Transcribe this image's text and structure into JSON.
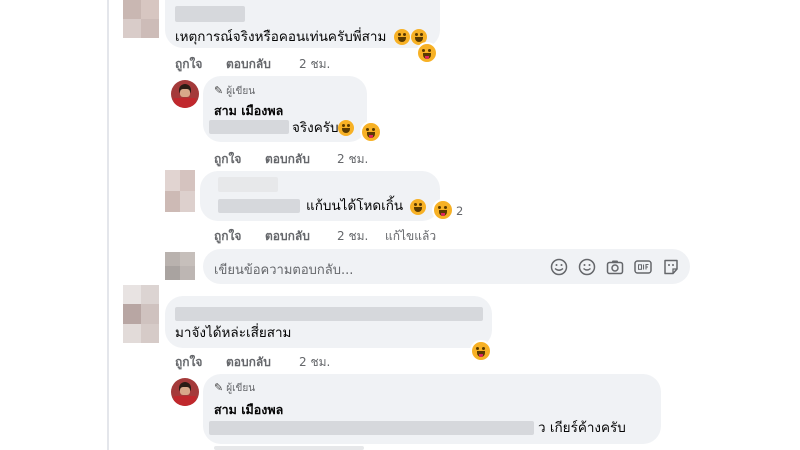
{
  "comments": [
    {
      "text": "เหตุการณ์จริงหรือคอนเท่นครับพี่สาม",
      "actions": {
        "like": "ถูกใจ",
        "reply": "ตอบกลับ",
        "time": "2 ชม."
      }
    },
    {
      "author_badge": "ผู้เขียน",
      "author_name": "สาม เมืองพล",
      "text": "จริงครับ",
      "actions": {
        "like": "ถูกใจ",
        "reply": "ตอบกลับ",
        "time": "2 ชม."
      }
    },
    {
      "text": "แก้บนได้โหดเกิ้น",
      "reaction_count": "2",
      "actions": {
        "like": "ถูกใจ",
        "reply": "ตอบกลับ",
        "time": "2 ชม.",
        "edited": "แก้ไขแล้ว"
      }
    },
    {
      "text": "มาจังได้หล่ะเสี่ยสาม",
      "actions": {
        "like": "ถูกใจ",
        "reply": "ตอบกลับ",
        "time": "2 ชม."
      }
    },
    {
      "author_badge": "ผู้เขียน",
      "author_name": "สาม เมืองพล",
      "text": "ว เกียร์ค้างครับ"
    }
  ],
  "reply_box": {
    "placeholder": "เขียนข้อความตอบกลับ..."
  },
  "colors": {
    "bubble": "#f0f2f5",
    "secondary_text": "#65676b",
    "emoji": "#f7b125"
  },
  "icons": [
    "pencil-icon",
    "sticker-icon",
    "emoji-icon",
    "camera-icon",
    "gif-icon",
    "avatar-sticker-icon",
    "laughing-reaction-icon"
  ]
}
